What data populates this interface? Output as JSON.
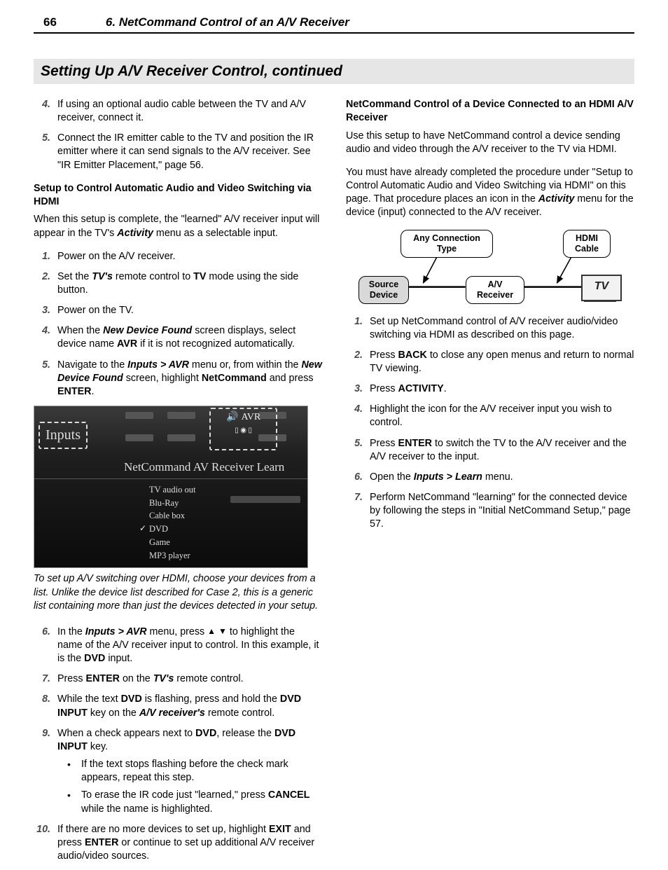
{
  "header": {
    "page_number": "66",
    "chapter": "6.  NetCommand Control of an A/V Receiver"
  },
  "section_title": "Setting Up A/V Receiver Control, continued",
  "left": {
    "cont_steps": [
      {
        "n": "4.",
        "runs": [
          {
            "t": "If using an optional audio cable between the TV and A/V receiver, connect it."
          }
        ]
      },
      {
        "n": "5.",
        "runs": [
          {
            "t": "Connect the IR emitter cable to the TV and position the IR emitter where it can send signals to the A/V receiver.  See \"IR Emitter Placement,\" page 56."
          }
        ]
      }
    ],
    "sub_heading_1": "Setup to Control Automatic Audio and Video Switching via HDMI",
    "para_1_pre": "When this setup is complete, the \"learned\" A/V receiver input will appear in the TV's ",
    "para_1_bold": "Activity",
    "para_1_post": " menu as a selectable input.",
    "steps_a": [
      {
        "n": "1.",
        "runs": [
          {
            "t": "Power on the A/V receiver."
          }
        ]
      },
      {
        "n": "2.",
        "runs": [
          {
            "t": "Set the "
          },
          {
            "t": "TV's",
            "cls": "bi"
          },
          {
            "t": " remote control to "
          },
          {
            "t": "TV",
            "cls": "sc"
          },
          {
            "t": " mode using the side button."
          }
        ]
      },
      {
        "n": "3.",
        "runs": [
          {
            "t": "Power on the TV."
          }
        ]
      },
      {
        "n": "4.",
        "runs": [
          {
            "t": "When the "
          },
          {
            "t": "New Device Found",
            "cls": "bi"
          },
          {
            "t": " screen displays, select device name "
          },
          {
            "t": "AVR",
            "cls": "sc"
          },
          {
            "t": " if it is not recognized automatically."
          }
        ]
      },
      {
        "n": "5.",
        "runs": [
          {
            "t": "Navigate to the "
          },
          {
            "t": "Inputs > AVR",
            "cls": "bi"
          },
          {
            "t": " menu or, from within the "
          },
          {
            "t": "New Device Found",
            "cls": "bi"
          },
          {
            "t": " screen, highlight "
          },
          {
            "t": "NetCommand",
            "cls": "b"
          },
          {
            "t": " and press "
          },
          {
            "t": "ENTER",
            "cls": "sc"
          },
          {
            "t": "."
          }
        ]
      }
    ],
    "screenshot": {
      "inputs_label": "Inputs",
      "avr_label": "AVR",
      "panel_title": "NetCommand AV Receiver Learn",
      "list": [
        "TV audio out",
        "Blu-Ray",
        "Cable box",
        "DVD",
        "Game",
        "MP3 player"
      ],
      "checked_index": 3
    },
    "caption": "To set up A/V switching over HDMI, choose your devices from a list.  Unlike the device list described for Case 2, this is a generic list containing more than just the devices detected in your setup.",
    "steps_b": [
      {
        "n": "6.",
        "runs": [
          {
            "t": "In the "
          },
          {
            "t": "Inputs > AVR",
            "cls": "bi"
          },
          {
            "t": " menu, press "
          },
          {
            "t": "▲",
            "cls": "arrow"
          },
          {
            "t": " "
          },
          {
            "t": "▼",
            "cls": "arrow"
          },
          {
            "t": " to highlight the name of the A/V receiver input to control.  In this example, it is the "
          },
          {
            "t": "DVD",
            "cls": "b"
          },
          {
            "t": " input."
          }
        ]
      },
      {
        "n": "7.",
        "runs": [
          {
            "t": "Press "
          },
          {
            "t": "ENTER",
            "cls": "sc"
          },
          {
            "t": " on the "
          },
          {
            "t": "TV's",
            "cls": "bi"
          },
          {
            "t": " remote control."
          }
        ]
      },
      {
        "n": "8.",
        "runs": [
          {
            "t": "While the text "
          },
          {
            "t": "DVD",
            "cls": "b"
          },
          {
            "t": " is flashing, press and hold the "
          },
          {
            "t": "DVD INPUT",
            "cls": "sc"
          },
          {
            "t": " key on the "
          },
          {
            "t": "A/V receiver's",
            "cls": "bi"
          },
          {
            "t": " remote control."
          }
        ]
      },
      {
        "n": "9.",
        "runs": [
          {
            "t": "When a check appears next to "
          },
          {
            "t": "DVD",
            "cls": "b"
          },
          {
            "t": ", release the "
          },
          {
            "t": "DVD INPUT",
            "cls": "sc"
          },
          {
            "t": " key."
          }
        ],
        "subs": [
          "If the text stops flashing before the check mark appears, repeat this step.",
          ""
        ],
        "sub_runs": [
          [
            {
              "t": "If the text stops flashing before the check mark appears, repeat this step."
            }
          ],
          [
            {
              "t": "To erase the IR code just \"learned,\" press "
            },
            {
              "t": "CANCEL",
              "cls": "sc"
            },
            {
              "t": " while the name is highlighted."
            }
          ]
        ]
      },
      {
        "n": "10.",
        "runs": [
          {
            "t": "If there are no more devices to set up, highlight "
          },
          {
            "t": "EXIT",
            "cls": "b"
          },
          {
            "t": " and press "
          },
          {
            "t": "ENTER",
            "cls": "sc"
          },
          {
            "t": " or continue to set up additional A/V receiver audio/video sources."
          }
        ]
      }
    ]
  },
  "right": {
    "sub_heading": "NetCommand Control of a Device Connected to an HDMI A/V Receiver",
    "para_1": "Use this setup to have NetCommand control a device sending audio and video through the A/V receiver to the TV via HDMI.",
    "para_2_pre": "You must have already completed the procedure under \"Setup to Control Automatic Audio and Video Switching via HDMI\" on this page.  That procedure  places an icon in the ",
    "para_2_bold": "Activity",
    "para_2_post": " menu for the device (input) connected to the A/V receiver.",
    "diagram": {
      "any_conn": "Any Connection Type",
      "hdmi": "HDMI Cable",
      "source": "Source Device",
      "avr": "A/V Receiver",
      "tv": "TV"
    },
    "steps": [
      {
        "n": "1.",
        "runs": [
          {
            "t": "Set up NetCommand control of A/V receiver audio/video switching via HDMI as described on this page."
          }
        ]
      },
      {
        "n": "2.",
        "runs": [
          {
            "t": "Press "
          },
          {
            "t": "BACK",
            "cls": "sc"
          },
          {
            "t": " to close any open menus and return to normal TV viewing."
          }
        ]
      },
      {
        "n": "3.",
        "runs": [
          {
            "t": "Press "
          },
          {
            "t": "ACTIVITY",
            "cls": "sc"
          },
          {
            "t": "."
          }
        ]
      },
      {
        "n": "4.",
        "runs": [
          {
            "t": "Highlight the icon for the A/V receiver input you wish to control."
          }
        ]
      },
      {
        "n": "5.",
        "runs": [
          {
            "t": "Press "
          },
          {
            "t": "ENTER",
            "cls": "sc"
          },
          {
            "t": " to switch the TV to the A/V receiver and the A/V receiver to the input."
          }
        ]
      },
      {
        "n": "6.",
        "runs": [
          {
            "t": "Open the "
          },
          {
            "t": "Inputs > Learn",
            "cls": "bi"
          },
          {
            "t": " menu."
          }
        ]
      },
      {
        "n": "7.",
        "runs": [
          {
            "t": "Perform NetCommand \"learning\" for the connected device by following the steps in \"Initial NetCommand Setup,\" page 57."
          }
        ]
      }
    ]
  }
}
